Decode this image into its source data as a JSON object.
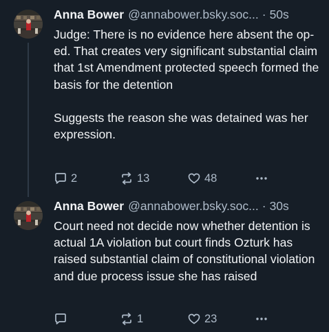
{
  "posts": [
    {
      "author_name": "Anna Bower",
      "author_handle": "@annabower.bsky.soc...",
      "separator": "·",
      "time": "50s",
      "text": "Judge: There is no evidence here absent the op-ed. That creates very significant substantial claim that 1st Amendment protected speech formed the basis for the detention\n\nSuggests the reason she was detained was her expression.",
      "replies": "2",
      "reposts": "13",
      "likes": "48"
    },
    {
      "author_name": "Anna Bower",
      "author_handle": "@annabower.bsky.soc...",
      "separator": "·",
      "time": "30s",
      "text": "Court need not decide now whether detention is actual 1A violation but court finds Ozturk has raised substantial claim of constitutional violation and due process issue she has raised",
      "replies": "",
      "reposts": "1",
      "likes": "23"
    }
  ],
  "icons": {
    "reply": "speech-bubble-icon",
    "repost": "repost-arrows-icon",
    "like": "heart-icon",
    "more": "ellipsis-icon"
  },
  "colors": {
    "background": "#161e27",
    "text": "#f1f3f5",
    "muted": "#aebbc9"
  }
}
